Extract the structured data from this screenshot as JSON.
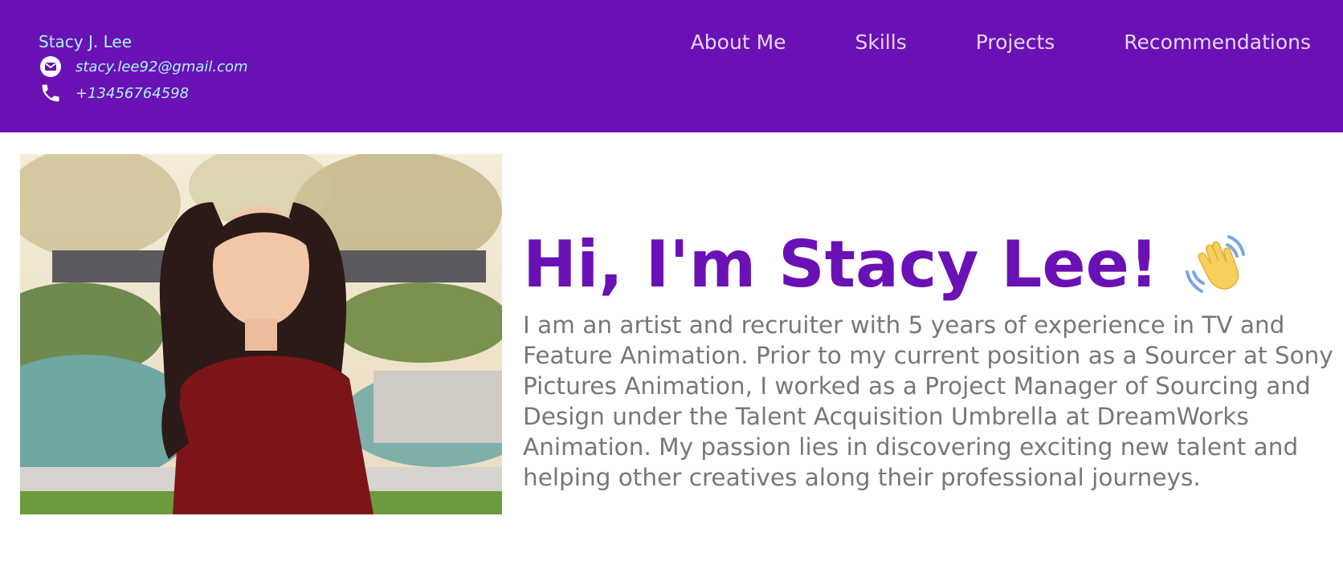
{
  "header": {
    "name": "Stacy J. Lee",
    "email": "stacy.lee92@gmail.com",
    "phone": "+13456764598",
    "email_icon": "envelope-icon",
    "phone_icon": "phone-icon"
  },
  "nav": {
    "items": [
      "About Me",
      "Skills",
      "Projects",
      "Recommendations"
    ]
  },
  "hero": {
    "title": "Hi, I'm Stacy Lee!",
    "emoji": "waving-hand-icon",
    "bio": "I am an artist and recruiter with 5 years of experience in TV and Feature Animation. Prior to my current position as a Sourcer at Sony Pictures Animation, I worked as a Project Manager of Sourcing and Design under the Talent Acquisition Umbrella at DreamWorks Animation. My passion lies in discovering exciting new talent and helping other creatives along their professional journeys."
  },
  "colors": {
    "header_bg": "#6a11b5",
    "contact_text": "#a8f5f0",
    "nav_text": "#e4d7f2",
    "title": "#6a11b5",
    "body_text": "#777777"
  }
}
